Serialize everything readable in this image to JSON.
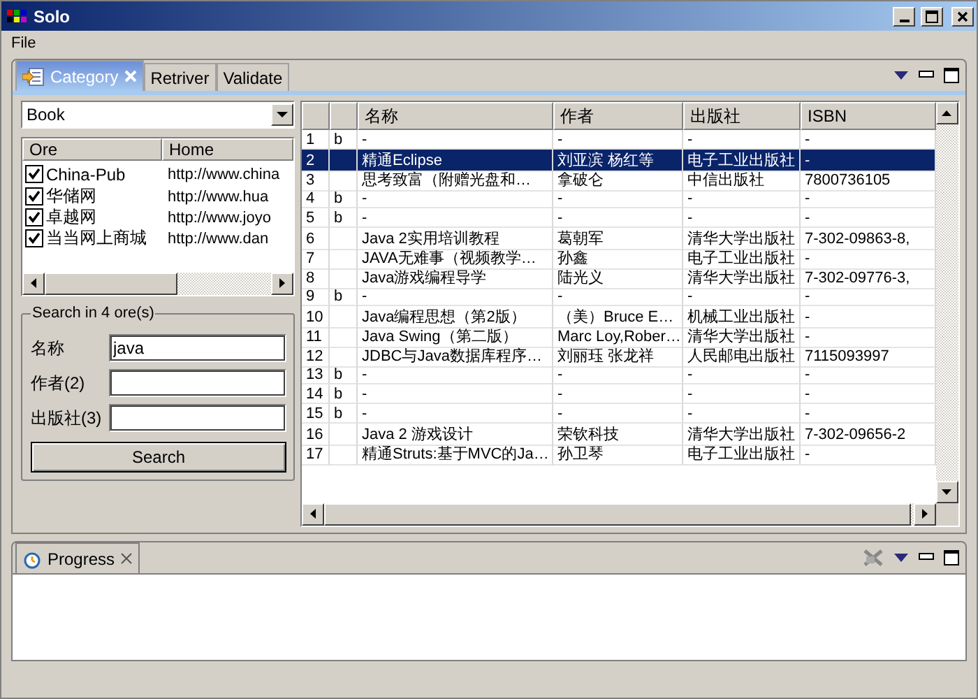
{
  "window": {
    "title": "Solo"
  },
  "menu": [
    {
      "label": "File"
    }
  ],
  "main_view": {
    "tabs": [
      {
        "label": "Category",
        "selected": true,
        "closable": true
      },
      {
        "label": "Retriver",
        "selected": false,
        "closable": false
      },
      {
        "label": "Validate",
        "selected": false,
        "closable": false
      }
    ],
    "category": {
      "combo": {
        "value": "Book"
      },
      "ore_table": {
        "columns": [
          "Ore",
          "Home"
        ],
        "rows": [
          {
            "checked": true,
            "name": "China-Pub",
            "home": "http://www.china"
          },
          {
            "checked": true,
            "name": "华储网",
            "home": "http://www.hua"
          },
          {
            "checked": true,
            "name": "卓越网",
            "home": "http://www.joyo"
          },
          {
            "checked": true,
            "name": "当当网上商城",
            "home": "http://www.dan"
          }
        ]
      },
      "search": {
        "title": "Search in 4 ore(s)",
        "fields": [
          {
            "label": "名称",
            "value": "java"
          },
          {
            "label": "作者(2)"
          },
          {
            "label": "出版社(3)"
          }
        ],
        "button": "Search"
      }
    },
    "results": {
      "columns": [
        "名称",
        "作者",
        "出版社",
        "ISBN"
      ],
      "rows": [
        {
          "number": "1",
          "mark": "b",
          "title": "-",
          "author": "-",
          "publisher": "-",
          "isbn": "-",
          "selected": false
        },
        {
          "number": "2",
          "title": "精通Eclipse",
          "author": "刘亚滨 杨红等",
          "publisher": "电子工业出版社",
          "isbn": "-",
          "selected": true
        },
        {
          "number": "3",
          "title": "思考致富（附赠光盘和…",
          "author": "拿破仑",
          "publisher": "中信出版社",
          "isbn": "7800736105",
          "selected": false
        },
        {
          "number": "4",
          "mark": "b",
          "title": "-",
          "author": "-",
          "publisher": "-",
          "isbn": "-",
          "selected": false
        },
        {
          "number": "5",
          "mark": "b",
          "title": "-",
          "author": "-",
          "publisher": "-",
          "isbn": "-",
          "selected": false
        },
        {
          "number": "6",
          "title": "Java 2实用培训教程",
          "author": "葛朝军",
          "publisher": "清华大学出版社",
          "isbn": "7-302-09863-8,",
          "selected": false
        },
        {
          "number": "7",
          "title": "JAVA无难事（视频教学…",
          "author": "孙鑫",
          "publisher": "电子工业出版社",
          "isbn": "-",
          "selected": false
        },
        {
          "number": "8",
          "title": "Java游戏编程导学",
          "author": "陆光义",
          "publisher": "清华大学出版社",
          "isbn": "7-302-09776-3,",
          "selected": false
        },
        {
          "number": "9",
          "mark": "b",
          "title": "-",
          "author": "-",
          "publisher": "-",
          "isbn": "-",
          "selected": false
        },
        {
          "number": "10",
          "title": "Java编程思想（第2版）",
          "author": "（美）Bruce E…",
          "publisher": "机械工业出版社",
          "isbn": "-",
          "selected": false
        },
        {
          "number": "11",
          "title": "Java Swing（第二版）",
          "author": "Marc Loy,Rober…",
          "publisher": "清华大学出版社",
          "isbn": "-",
          "selected": false
        },
        {
          "number": "12",
          "title": "JDBC与Java数据库程序…",
          "author": "刘丽珏 张龙祥",
          "publisher": "人民邮电出版社",
          "isbn": "7115093997",
          "selected": false
        },
        {
          "number": "13",
          "mark": "b",
          "title": "-",
          "author": "-",
          "publisher": "-",
          "isbn": "-",
          "selected": false
        },
        {
          "number": "14",
          "mark": "b",
          "title": "-",
          "author": "-",
          "publisher": "-",
          "isbn": "-",
          "selected": false
        },
        {
          "number": "15",
          "mark": "b",
          "title": "-",
          "author": "-",
          "publisher": "-",
          "isbn": "-",
          "selected": false
        },
        {
          "number": "16",
          "title": "Java 2 游戏设计",
          "author": "荣钦科技",
          "publisher": "清华大学出版社",
          "isbn": "7-302-09656-2",
          "selected": false
        },
        {
          "number": "17",
          "title": "精通Struts:基于MVC的Ja…",
          "author": "孙卫琴",
          "publisher": "电子工业出版社",
          "isbn": "-",
          "selected": false
        }
      ]
    }
  },
  "progress_view": {
    "tabs": [
      {
        "label": "Progress",
        "selected": true,
        "closable": true
      }
    ]
  }
}
